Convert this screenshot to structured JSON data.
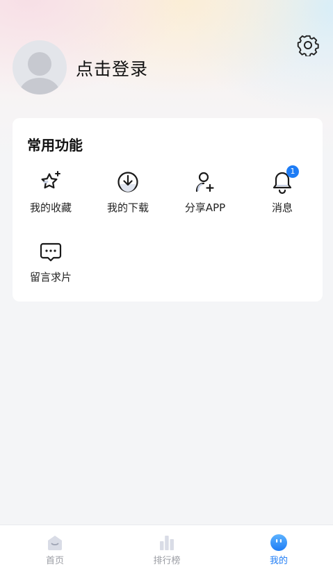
{
  "header": {
    "login_text": "点击登录",
    "settings_icon": "gear-icon",
    "avatar_icon": "default-avatar"
  },
  "functions": {
    "title": "常用功能",
    "items": [
      {
        "label": "我的收藏",
        "icon": "star-sparkle-icon"
      },
      {
        "label": "我的下载",
        "icon": "download-icon"
      },
      {
        "label": "分享APP",
        "icon": "user-add-icon"
      },
      {
        "label": "消息",
        "icon": "bell-icon",
        "badge": "1"
      },
      {
        "label": "留言求片",
        "icon": "message-icon"
      }
    ]
  },
  "tabbar": {
    "items": [
      {
        "label": "首页",
        "icon": "home-icon"
      },
      {
        "label": "排行榜",
        "icon": "chart-icon"
      },
      {
        "label": "我的",
        "icon": "profile-face-icon",
        "active": true
      }
    ]
  },
  "colors": {
    "accent": "#1e7cf5",
    "inactive": "#9a9ca3",
    "background": "#f4f5f7"
  }
}
